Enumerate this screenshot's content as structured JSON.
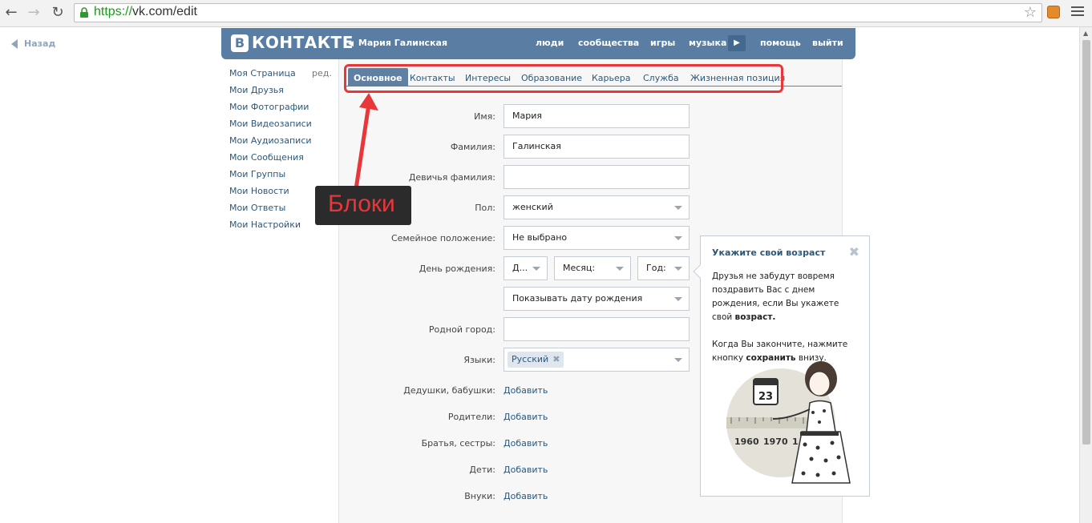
{
  "browser": {
    "url_protocol": "https://",
    "url_rest": "vk.com/edit",
    "back_icon": "back-arrow-icon",
    "forward_icon": "forward-arrow-icon",
    "reload_icon": "reload-icon"
  },
  "back_link": "Назад",
  "header": {
    "logo_letter": "В",
    "logo_text": "КОНТАКТЕ",
    "user_name": "Мария Галинская",
    "nav": [
      "люди",
      "сообщества",
      "игры",
      "музыка",
      "помощь",
      "выйти"
    ]
  },
  "left_menu": {
    "edit": "ред.",
    "items": [
      "Моя Страница",
      "Мои Друзья",
      "Мои Фотографии",
      "Мои Видеозаписи",
      "Мои Аудиозаписи",
      "Мои Сообщения",
      "Мои Группы",
      "Мои Новости",
      "Мои Ответы",
      "Мои Настройки"
    ]
  },
  "tabs": [
    "Основное",
    "Контакты",
    "Интересы",
    "Образование",
    "Карьера",
    "Служба",
    "Жизненная позиция"
  ],
  "form": {
    "first_name_label": "Имя:",
    "first_name": "Мария",
    "last_name_label": "Фамилия:",
    "last_name": "Галинская",
    "maiden_label": "Девичья фамилия:",
    "maiden": "",
    "gender_label": "Пол:",
    "gender": "женский",
    "marital_label": "Семейное положение:",
    "marital": "Не выбрано",
    "birthday_label": "День рождения:",
    "day": "Д...",
    "month": "Месяц:",
    "year": "Год:",
    "show_birthday": "Показывать дату рождения",
    "hometown_label": "Родной город:",
    "hometown": "",
    "languages_label": "Языки:",
    "language_tag": "Русский",
    "grandparents_label": "Дедушки, бабушки:",
    "parents_label": "Родители:",
    "siblings_label": "Братья, сестры:",
    "children_label": "Дети:",
    "grandchildren_label": "Внуки:",
    "add": "Добавить"
  },
  "tooltip": {
    "title": "Укажите свой возраст",
    "p1_a": "Друзья не забудут вовремя поздравить Вас с днем рождения, если Вы укажете свой ",
    "p1_b": "возраст.",
    "p2_a": "Когда Вы закончите, нажмите кнопку ",
    "p2_b": "сохранить",
    "p2_c": " внизу.",
    "calendar_day": "23",
    "years": [
      "1960",
      "1970",
      "1"
    ]
  },
  "annotation": {
    "label": "Блоки",
    "color": "#e8373b"
  },
  "colors": {
    "vk_blue": "#597da3",
    "link": "#2b587a",
    "highlight": "#e8373b"
  }
}
